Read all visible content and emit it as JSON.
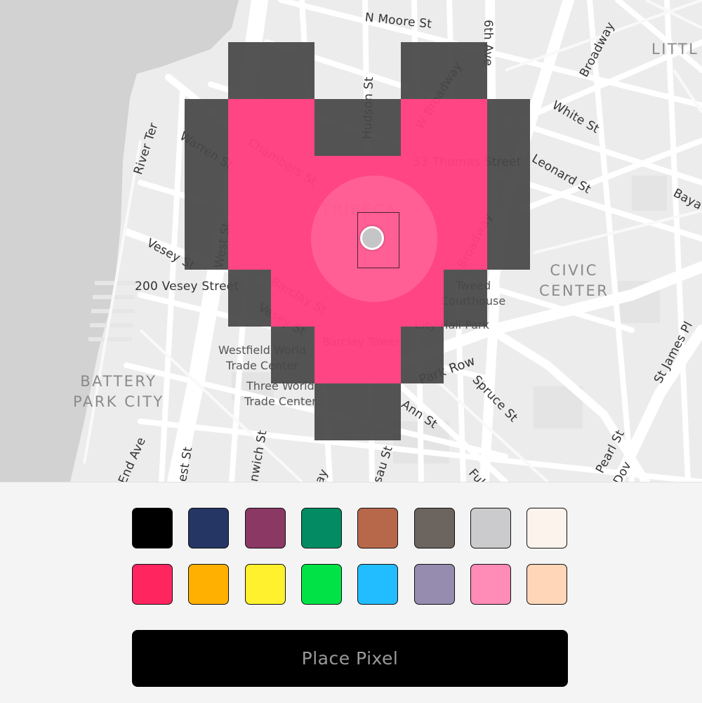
{
  "map": {
    "street_labels": [
      {
        "name": "N Moore St"
      },
      {
        "name": "6th Ave"
      },
      {
        "name": "Broadway"
      },
      {
        "name": "Hudson St"
      },
      {
        "name": "W Broadway"
      },
      {
        "name": "White St"
      },
      {
        "name": "River Ter"
      },
      {
        "name": "Warren St"
      },
      {
        "name": "Chambers St"
      },
      {
        "name": "33 Thomas Street"
      },
      {
        "name": "Leonard St"
      },
      {
        "name": "Baya"
      },
      {
        "name": "Vesey St"
      },
      {
        "name": "West St"
      },
      {
        "name": "Broadway"
      },
      {
        "name": "200 Vesey Street"
      },
      {
        "name": "Barclay St"
      },
      {
        "name": "Vesey St"
      },
      {
        "name": "Park Row"
      },
      {
        "name": "St James Pl"
      },
      {
        "name": "Spruce St"
      },
      {
        "name": "Ann St"
      },
      {
        "name": "Pearl St"
      },
      {
        "name": "Dov"
      },
      {
        "name": "End Ave"
      },
      {
        "name": "est St"
      },
      {
        "name": "nwich St"
      },
      {
        "name": "ay"
      },
      {
        "name": "sau St"
      },
      {
        "name": "Fult"
      }
    ],
    "district_labels": [
      {
        "name": "LITTL"
      },
      {
        "name": "TRIBECA"
      },
      {
        "name": "CIVIC\nCENTER"
      },
      {
        "name": "BATTERY\nPARK CITY"
      }
    ],
    "poi_labels": [
      {
        "name": "Tweed\nCourthouse"
      },
      {
        "name": "City Hall Park"
      },
      {
        "name": "Barclay Tower"
      },
      {
        "name": "Westfield World\nTrade Center"
      },
      {
        "name": "Three World\nTrade Center"
      }
    ]
  },
  "pixel_art": {
    "colors": {
      "pink": "#ff3d7f",
      "dark": "#474747"
    },
    "pixels": [
      {
        "color": "dark",
        "cell": [
          1,
          0
        ]
      },
      {
        "color": "dark",
        "cell": [
          2,
          0
        ]
      },
      {
        "color": "dark",
        "cell": [
          5,
          0
        ]
      },
      {
        "color": "dark",
        "cell": [
          6,
          0
        ]
      },
      {
        "color": "dark",
        "cell": [
          0,
          1
        ]
      },
      {
        "color": "pink",
        "cell": [
          1,
          1
        ]
      },
      {
        "color": "pink",
        "cell": [
          2,
          1
        ]
      },
      {
        "color": "dark",
        "cell": [
          3,
          1
        ]
      },
      {
        "color": "dark",
        "cell": [
          4,
          1
        ]
      },
      {
        "color": "pink",
        "cell": [
          5,
          1
        ]
      },
      {
        "color": "pink",
        "cell": [
          6,
          1
        ]
      },
      {
        "color": "dark",
        "cell": [
          7,
          1
        ]
      },
      {
        "color": "dark",
        "cell": [
          0,
          2
        ]
      },
      {
        "color": "pink",
        "cell": [
          1,
          2
        ]
      },
      {
        "color": "pink",
        "cell": [
          2,
          2
        ]
      },
      {
        "color": "pink",
        "cell": [
          3,
          2
        ]
      },
      {
        "color": "pink",
        "cell": [
          4,
          2
        ]
      },
      {
        "color": "pink",
        "cell": [
          5,
          2
        ]
      },
      {
        "color": "pink",
        "cell": [
          6,
          2
        ]
      },
      {
        "color": "dark",
        "cell": [
          7,
          2
        ]
      },
      {
        "color": "dark",
        "cell": [
          0,
          3
        ]
      },
      {
        "color": "pink",
        "cell": [
          1,
          3
        ]
      },
      {
        "color": "pink",
        "cell": [
          2,
          3
        ]
      },
      {
        "color": "pink",
        "cell": [
          3,
          3
        ]
      },
      {
        "color": "pink",
        "cell": [
          4,
          3
        ]
      },
      {
        "color": "pink",
        "cell": [
          5,
          3
        ]
      },
      {
        "color": "pink",
        "cell": [
          6,
          3
        ]
      },
      {
        "color": "dark",
        "cell": [
          7,
          3
        ]
      },
      {
        "color": "dark",
        "cell": [
          1,
          4
        ]
      },
      {
        "color": "pink",
        "cell": [
          2,
          4
        ]
      },
      {
        "color": "pink",
        "cell": [
          3,
          4
        ]
      },
      {
        "color": "pink",
        "cell": [
          4,
          4
        ]
      },
      {
        "color": "pink",
        "cell": [
          5,
          4
        ]
      },
      {
        "color": "dark",
        "cell": [
          6,
          4
        ]
      },
      {
        "color": "dark",
        "cell": [
          2,
          5
        ]
      },
      {
        "color": "pink",
        "cell": [
          3,
          5
        ]
      },
      {
        "color": "pink",
        "cell": [
          4,
          5
        ]
      },
      {
        "color": "dark",
        "cell": [
          5,
          5
        ]
      },
      {
        "color": "dark",
        "cell": [
          3,
          6
        ]
      },
      {
        "color": "dark",
        "cell": [
          4,
          6
        ]
      }
    ]
  },
  "palette": {
    "colors": [
      "#000000",
      "#253665",
      "#8b3865",
      "#038c63",
      "#b8684a",
      "#6b645f",
      "#cbcbcd",
      "#fdf3ed",
      "#ff2660",
      "#ffb000",
      "#fff12e",
      "#00e245",
      "#22bdff",
      "#958caf",
      "#ff8bb7",
      "#ffd6b7"
    ]
  },
  "place_button": {
    "label": "Place Pixel"
  }
}
